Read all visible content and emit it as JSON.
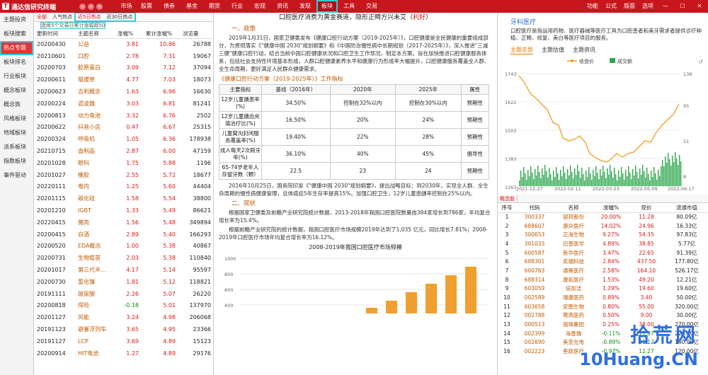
{
  "app": {
    "title": "通达信研究终端"
  },
  "menu": [
    "市场",
    "股票",
    "债券",
    "基金",
    "期货",
    "行业",
    "宏观",
    "资讯",
    "发现",
    "板块",
    "工具",
    "交易"
  ],
  "right_menu": [
    "功能",
    "公式",
    "版面",
    "选项"
  ],
  "sidebar": [
    "主题投资",
    "板块搜索",
    "热点专题",
    "板块排名",
    "行业板块",
    "概念板块",
    "概念族",
    "风格板块",
    "地域板块",
    "派系板块",
    "指数板块",
    "事件驱动"
  ],
  "left": {
    "tabs": [
      "全部",
      "人气热点",
      "近5日热点",
      "近30日热点"
    ],
    "subnote": "连续5个交易日累计涨幅超50",
    "headers": [
      "更新时间",
      "主题名称",
      "涨幅%",
      "累计涨幅%",
      "浏览量"
    ],
    "rows": [
      [
        "20200430",
        "公益",
        "3.81",
        "10.86",
        "26788"
      ],
      [
        "20210601",
        "口腔",
        "2.78",
        "7.31",
        "19067"
      ],
      [
        "20200703",
        "胶原蛋白",
        "3.09",
        "7.12",
        "37094"
      ],
      [
        "20200611",
        "猫拔草",
        "4.77",
        "7.03",
        "18073"
      ],
      [
        "20200623",
        "吉利概念",
        "1.63",
        "6.96",
        "16630"
      ],
      [
        "20200224",
        "滤波器",
        "3.03",
        "6.81",
        "81241"
      ],
      [
        "20200813",
        "动力电池",
        "3.32",
        "6.76",
        "2502"
      ],
      [
        "20200622",
        "抖音小店",
        "0.47",
        "6.67",
        "25315"
      ],
      [
        "20200324",
        "呼吸机",
        "1.05",
        "6.36",
        "178938"
      ],
      [
        "20210715",
        "血制品",
        "2.87",
        "6.00",
        "47159"
      ],
      [
        "20201028",
        "眼科",
        "1.75",
        "5.88",
        "1196"
      ],
      [
        "20201027",
        "橡胶",
        "2.55",
        "5.72",
        "18677"
      ],
      [
        "20220111",
        "电内",
        "1.25",
        "5.60",
        "44404"
      ],
      [
        "20201115",
        "碳化硅",
        "1.58",
        "5.54",
        "38800"
      ],
      [
        "20201210",
        "IGBT",
        "1.33",
        "5.49",
        "86621"
      ],
      [
        "20220415",
        "猪肉",
        "1.56",
        "5.48",
        "349894"
      ],
      [
        "20200415",
        "白酒",
        "2.89",
        "5.40",
        "166293"
      ],
      [
        "20200520",
        "EDA概念",
        "1.00",
        "5.38",
        "40867"
      ],
      [
        "20200731",
        "生物疫苗",
        "2.03",
        "5.38",
        "110840"
      ],
      [
        "20201017",
        "第三代半...",
        "4.17",
        "5.14",
        "95597"
      ],
      [
        "20200730",
        "氢化镍",
        "1.81",
        "5.12",
        "118821"
      ],
      [
        "20191111",
        "玻尿酸",
        "2.26",
        "5.07",
        "26220"
      ],
      [
        "20200818",
        "保险",
        "-0.18",
        "5.01",
        "137970"
      ],
      [
        "20201127",
        "风能",
        "3.24",
        "4.98",
        "206068"
      ],
      [
        "20191123",
        "避暑浮列车",
        "3.65",
        "4.95",
        "23366"
      ],
      [
        "20191127",
        "LCP",
        "3.69",
        "4.89",
        "15123"
      ],
      [
        "20200914",
        "HIT电池",
        "1.27",
        "4.89",
        "29176"
      ]
    ]
  },
  "article": {
    "title_main": "口腔医疗消费为黄金赛道，隐形正畸方兴未艾（",
    "title_tag": "利好",
    "title_end": "）",
    "sec1": "一、政策",
    "p1": "2019年1月31日，国家卫健委发布《健康口腔行动方案（2019-2025年）》，口腔健康是全民健康的重要组成部分，为贯彻落实《\"健康中国 2030\"规划纲要》和《中国防治慢性病中长期规划（2017-2025年）》，深入推进\"三减三健\"健康口腔行动，结合当前中国口腔健康状况和口腔卫生工作现况，制定本方案。旨在加快推进口腔健康服务体系，包括社会支持性环境基本形成，人群口腔健康素养水平和健康行为形成率大幅提升，口腔健康服务覆盖全人群、全生命周期，更好满足人民群众健康需求。",
    "table_title": "《健康口腔行动方案（2019-2025年）》工作指标",
    "table_headers": [
      "主要指标",
      "基线（2016年）",
      "2020年",
      "2025年",
      "属性"
    ],
    "table_rows": [
      [
        "12岁儿童龋患率(%)",
        "34.50%",
        "控制在32%以内",
        "控制在30%以内",
        "预期性"
      ],
      [
        "12岁儿童龋齿充填治疗比(%)",
        "16.50%",
        "20%",
        "24%",
        "预期性"
      ],
      [
        "儿童窝沟封闭服务覆盖率(%)",
        "19.40%",
        "22%",
        "28%",
        "预期性"
      ],
      [
        "成人每天2次刷牙率(%)",
        "36.10%",
        "40%",
        "45%",
        "倡导性"
      ],
      [
        "65-74岁老年人存留牙数（颗）",
        "22.5",
        "23",
        "24",
        "预期性"
      ]
    ],
    "p2": "2016年10月25日，国务院印发《\"健康中国 2030\"规划纲要》，提出战略目标：到2030年，实现全人群、全生命周期的慢性病健康管理，总体癌症5年生存率提高15%。加强口腔卫生，12岁儿童患龋率控制在25%以内。",
    "sec2": "二、现状",
    "p3": "根据国家卫健委及前瞻产业研究院统计数据，2013-2018年我国口腔医院数量由384家增长到786家，年均复合增长率为15.4%。",
    "p4": "根据前瞻产业研究院的统计数据，我国口腔医疗市场规模2019年达到了1,035 亿元，同比增长7.81%；2008-2019年口腔医疗市场年均复合增长率为16.12%。",
    "chart_title": "2008-2019年我国口腔医疗市场规模",
    "chart_ylabels": [
      "1000",
      "800",
      "600",
      "400"
    ]
  },
  "right": {
    "title": "牙科医疗",
    "desc": "口腔医疗是指运用药物、医疗器械等医疗工具为口腔患者和美牙需求者提供诊疗种植、正畸、修复、美白等医疗项目的服务。",
    "tabs": [
      "主题走势",
      "主题估值",
      "主题资讯"
    ],
    "legend": [
      "收盘价",
      "成交额"
    ],
    "colors": {
      "price": "#f0a020",
      "volume": "#2fa84f"
    },
    "y_left": [
      "1743",
      "1622",
      "1503",
      "1383",
      "1263"
    ],
    "y_right": [
      "138",
      "95",
      "51",
      "8"
    ],
    "x_labels": [
      "2021-12-27",
      "2022-02-11",
      "2022-03-23",
      "2022-05-09",
      "2022-06-17"
    ],
    "table_tab": "概念股",
    "headers": [
      "序号",
      "代码",
      "名称",
      "涨幅%",
      "现价",
      "流通市值"
    ],
    "rows": [
      [
        "1",
        "300337",
        "银邦股份",
        "20.00%",
        "11.28",
        "80.09亿"
      ],
      [
        "2",
        "688607",
        "康众医疗",
        "14.02%",
        "24.96",
        "16.33亿"
      ],
      [
        "3",
        "300653",
        "正海生物",
        "9.27%",
        "54.35",
        "97.83亿"
      ],
      [
        "4",
        "301033",
        "迈普医学",
        "4.89%",
        "38.85",
        "5.77亿"
      ],
      [
        "5",
        "600587",
        "新华医疗",
        "3.47%",
        "22.65",
        "91.39亿"
      ],
      [
        "6",
        "688301",
        "奕瑞科技",
        "2.84%",
        "437.50",
        "177.80亿"
      ],
      [
        "7",
        "600763",
        "通策医疗",
        "2.58%",
        "164.10",
        "526.17亿"
      ],
      [
        "8",
        "688314",
        "康拓医疗",
        "1.53%",
        "49.20",
        "12.21亿"
      ],
      [
        "9",
        "603059",
        "倍加洁",
        "1.29%",
        "19.60",
        "19.60亿"
      ],
      [
        "10",
        "002589",
        "瑞康医药",
        "0.89%",
        "3.40",
        "50.00亿"
      ],
      [
        "11",
        "603658",
        "安图生物",
        "0.80%",
        "55.00",
        "320.00亿"
      ],
      [
        "12",
        "002788",
        "鹭燕医药",
        "0.50%",
        "9.00",
        "30.00亿"
      ],
      [
        "13",
        "000513",
        "丽珠集团",
        "0.25%",
        "38.00",
        "270.00亿"
      ],
      [
        "14",
        "002399",
        "海普瑞",
        "-0.11%",
        "17.97",
        "220.00亿"
      ],
      [
        "15",
        "002690",
        "美亚光电",
        "-0.89%",
        "21.12",
        "140.00亿"
      ],
      [
        "16",
        "002223",
        "鱼跃医疗",
        "-0.97%",
        "12.27",
        "120.00亿"
      ]
    ]
  }
}
